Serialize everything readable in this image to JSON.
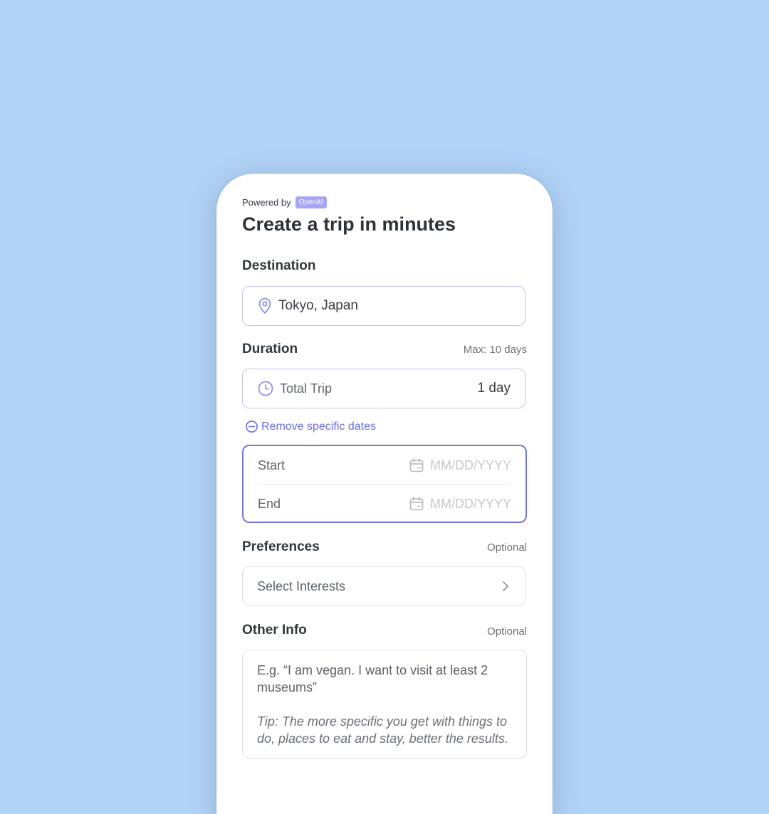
{
  "header": {
    "powered_by": "Powered by",
    "badge": "OpenAI",
    "title": "Create a trip in minutes"
  },
  "destination": {
    "label": "Destination",
    "value": "Tokyo, Japan",
    "icon": "location-pin-icon"
  },
  "duration": {
    "label": "Duration",
    "hint": "Max: 10 days",
    "field_label": "Total Trip",
    "value": "1 day",
    "icon": "clock-icon"
  },
  "remove_dates": {
    "label": "Remove specific dates",
    "icon": "minus-circle-icon"
  },
  "dates": {
    "start_label": "Start",
    "start_placeholder": "MM/DD/YYYY",
    "end_label": "End",
    "end_placeholder": "MM/DD/YYYY",
    "icon": "calendar-icon"
  },
  "preferences": {
    "label": "Preferences",
    "hint": "Optional",
    "field_label": "Select Interests",
    "icon": "chevron-right-icon"
  },
  "other_info": {
    "label": "Other Info",
    "hint": "Optional",
    "placeholder": "E.g. “I am vegan. I want to visit at least 2 museums”",
    "tip": "Tip: The more specific you get with things to do, places to eat and stay, better the results."
  },
  "colors": {
    "background": "#b1d3f6",
    "accent": "#7478de",
    "badge": "#a9a6f5"
  }
}
